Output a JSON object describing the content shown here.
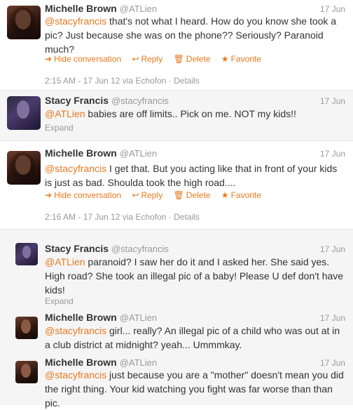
{
  "tweets": [
    {
      "name": "Michelle Brown",
      "handle": "@ATLien",
      "time": "17 Jun",
      "mention": "@stacyfrancis",
      "text": "that's not what I heard. How do you know she took a pic? Just because she was on the phone?? Seriously? Paranoid much?",
      "actions": {
        "hide": "Hide conversation",
        "reply": "Reply",
        "delete": "Delete",
        "favorite": "Favorite"
      },
      "meta": "2:15 AM - 17 Jun 12 via Echofon · Details"
    },
    {
      "name": "Stacy Francis",
      "handle": "@stacyfrancis",
      "time": "17 Jun",
      "mention": "@ATLien",
      "text": "babies are off limits.. Pick on me. NOT my kids!!",
      "expand": "Expand"
    },
    {
      "name": "Michelle Brown",
      "handle": "@ATLien",
      "time": "17 Jun",
      "mention": "@stacyfrancis",
      "text": "I get that. But you acting like that in front of your kids is just as bad. Shoulda took the high road....",
      "actions": {
        "hide": "Hide conversation",
        "reply": "Reply",
        "delete": "Delete",
        "favorite": "Favorite"
      },
      "meta": "2:16 AM - 17 Jun 12 via Echofon · Details"
    },
    {
      "name": "Stacy Francis",
      "handle": "@stacyfrancis",
      "time": "17 Jun",
      "mention": "@ATLien",
      "text": "paranoid? I saw her do it and I asked her. She said yes. High road? She took an illegal pic of a baby! Please U def don't have kids!",
      "expand": "Expand"
    },
    {
      "name": "Michelle Brown",
      "handle": "@ATLien",
      "time": "17 Jun",
      "mention": "@stacyfrancis",
      "text": "girl... really? An illegal pic of a child who was out at in a club district at midnight? yeah... Ummmkay."
    },
    {
      "name": "Michelle Brown",
      "handle": "@ATLien",
      "time": "17 Jun",
      "mention": "@stacyfrancis",
      "text": "just because you are a \"mother\" doesn't mean you did the right thing. Your kid watching you fight was far worse than than pic."
    }
  ]
}
